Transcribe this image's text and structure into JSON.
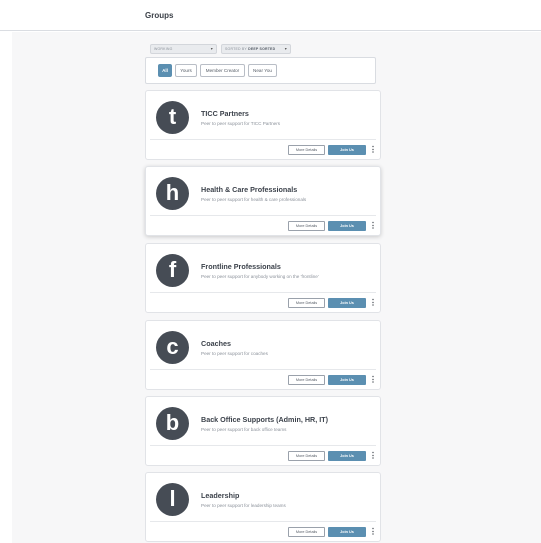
{
  "header": {
    "title": "Groups"
  },
  "filters": {
    "workspace_select": "WORKING",
    "sort_prefix": "SORTED BY",
    "sort_value": "DEEP SORTED",
    "chips": [
      {
        "label": "All",
        "active": true
      },
      {
        "label": "Yours",
        "active": false
      },
      {
        "label": "Member Creator",
        "active": false
      },
      {
        "label": "Near You",
        "active": false
      }
    ]
  },
  "groups": [
    {
      "letter": "t",
      "name": "TICC Partners",
      "description": "Peer to peer support for TICC Partners",
      "details_label": "More Details",
      "join_label": "Join Us"
    },
    {
      "letter": "h",
      "name": "Health & Care Professionals",
      "description": "Peer to peer support for health & care professionals",
      "details_label": "More Details",
      "join_label": "Join Us"
    },
    {
      "letter": "f",
      "name": "Frontline Professionals",
      "description": "Peer to peer support for anybody working on the 'frontline'",
      "details_label": "More Details",
      "join_label": "Join Us"
    },
    {
      "letter": "c",
      "name": "Coaches",
      "description": "Peer to peer support for coaches",
      "details_label": "More Details",
      "join_label": "Join Us"
    },
    {
      "letter": "b",
      "name": "Back Office Supports (Admin, HR, IT)",
      "description": "Peer to peer support for back office teams",
      "details_label": "More Details",
      "join_label": "Join Us"
    },
    {
      "letter": "l",
      "name": "Leadership",
      "description": "Peer to peer support for leadership teams",
      "details_label": "More Details",
      "join_label": "Join Us"
    }
  ],
  "icons": {
    "caret": "chevron-down-icon",
    "more": "kebab-menu-icon"
  },
  "colors": {
    "accent": "#5b8fb1",
    "avatar": "#464c55"
  }
}
